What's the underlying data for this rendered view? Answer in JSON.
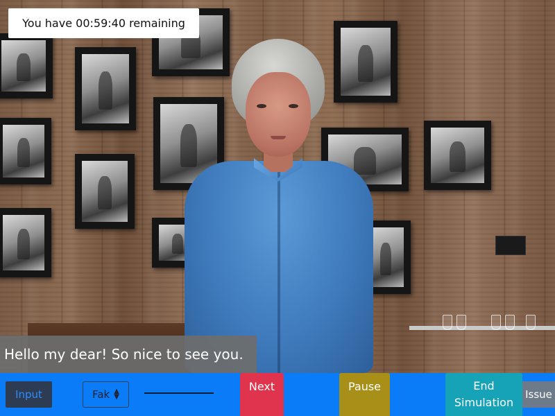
{
  "timer": {
    "text": "You have 00:59:40 remaining"
  },
  "subtitle": {
    "text": "Hello my dear! So nice to see you."
  },
  "controls": {
    "input_label": "Input",
    "voice_select": {
      "selected": "Fak",
      "arrow_icon": "select-arrows-icon"
    },
    "next_label": "Next",
    "pause_label": "Pause",
    "end_label": "End Simulation",
    "issue_label": "Issue"
  },
  "colors": {
    "control_bar": "#0b7cf7",
    "next_button": "#e0344e",
    "pause_button": "#a88f18",
    "end_button": "#16a3b8",
    "issue_button": "#6c7a89",
    "input_button": "#2d3c52"
  }
}
